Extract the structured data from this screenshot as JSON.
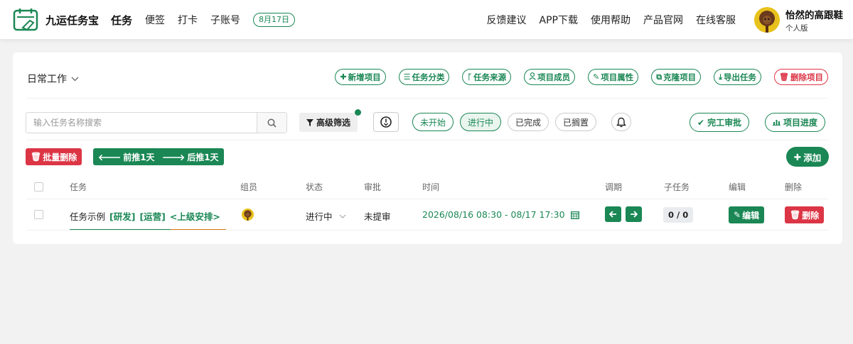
{
  "app": {
    "name": "九运任务宝"
  },
  "nav": {
    "left": [
      "任务",
      "便签",
      "打卡",
      "子账号"
    ],
    "date_badge": "8月17日",
    "right": [
      "反馈建议",
      "APP下载",
      "使用帮助",
      "产品官网",
      "在线客服"
    ]
  },
  "user": {
    "name": "怡然的高跟鞋",
    "level": "个人版"
  },
  "project": {
    "name": "日常工作",
    "buttons": [
      "新增项目",
      "任务分类",
      "任务来源",
      "项目成员",
      "项目属性",
      "克隆项目",
      "导出任务",
      "删除项目"
    ]
  },
  "filters": {
    "search_placeholder": "输入任务名称搜索",
    "advanced": "高级筛选",
    "statuses": [
      "未开始",
      "进行中",
      "已完成",
      "已搁置"
    ],
    "approve": "完工审批",
    "progress": "项目进度"
  },
  "actions": {
    "batch_delete": "批量删除",
    "prev_day": "前推1天",
    "next_day": "后推1天",
    "add": "添加"
  },
  "table": {
    "headers": [
      "任务",
      "组员",
      "状态",
      "审批",
      "时间",
      "调期",
      "子任务",
      "编辑",
      "删除"
    ],
    "rows": [
      {
        "task": "任务示例",
        "tags": [
          "[研发]",
          "[运营]",
          "<上级安排>"
        ],
        "status": "进行中",
        "approval": "未提审",
        "time": "2026/08/16 08:30 - 08/17 17:30",
        "subtasks": "0 / 0",
        "edit": "编辑",
        "delete": "删除"
      }
    ]
  },
  "colors": {
    "primary": "#1a8754",
    "danger": "#dc3545",
    "accent_line": "#e07a10"
  }
}
